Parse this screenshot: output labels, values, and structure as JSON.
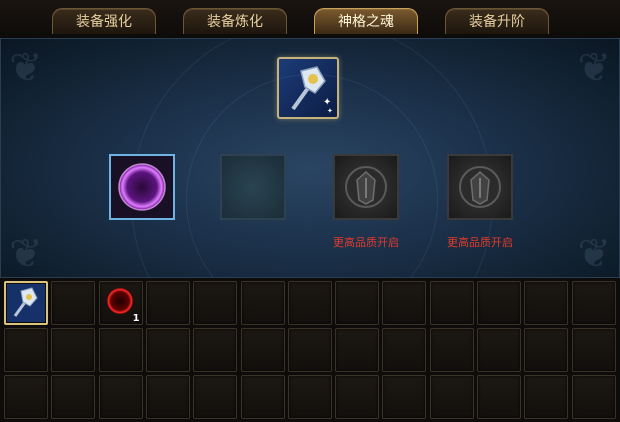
{
  "tabs": [
    {
      "label": "装备强化",
      "active": false
    },
    {
      "label": "装备炼化",
      "active": false
    },
    {
      "label": "神格之魂",
      "active": true
    },
    {
      "label": "装备升阶",
      "active": false
    }
  ],
  "gem_slots": {
    "locked_label_1": "更高品质开启",
    "locked_label_2": "更高品质开启"
  },
  "inventory": {
    "orb_count": "1"
  },
  "colors": {
    "accent_gold": "#c9a25a",
    "locked_text": "#e33a2a",
    "orb_purple": "#b44dff"
  },
  "icons": {
    "main_item": "crystal-staff-icon",
    "socket_filled": "purple-orb-icon",
    "socket_locked": "helmet-crest-icon",
    "inventory_orb": "red-orb-icon"
  }
}
